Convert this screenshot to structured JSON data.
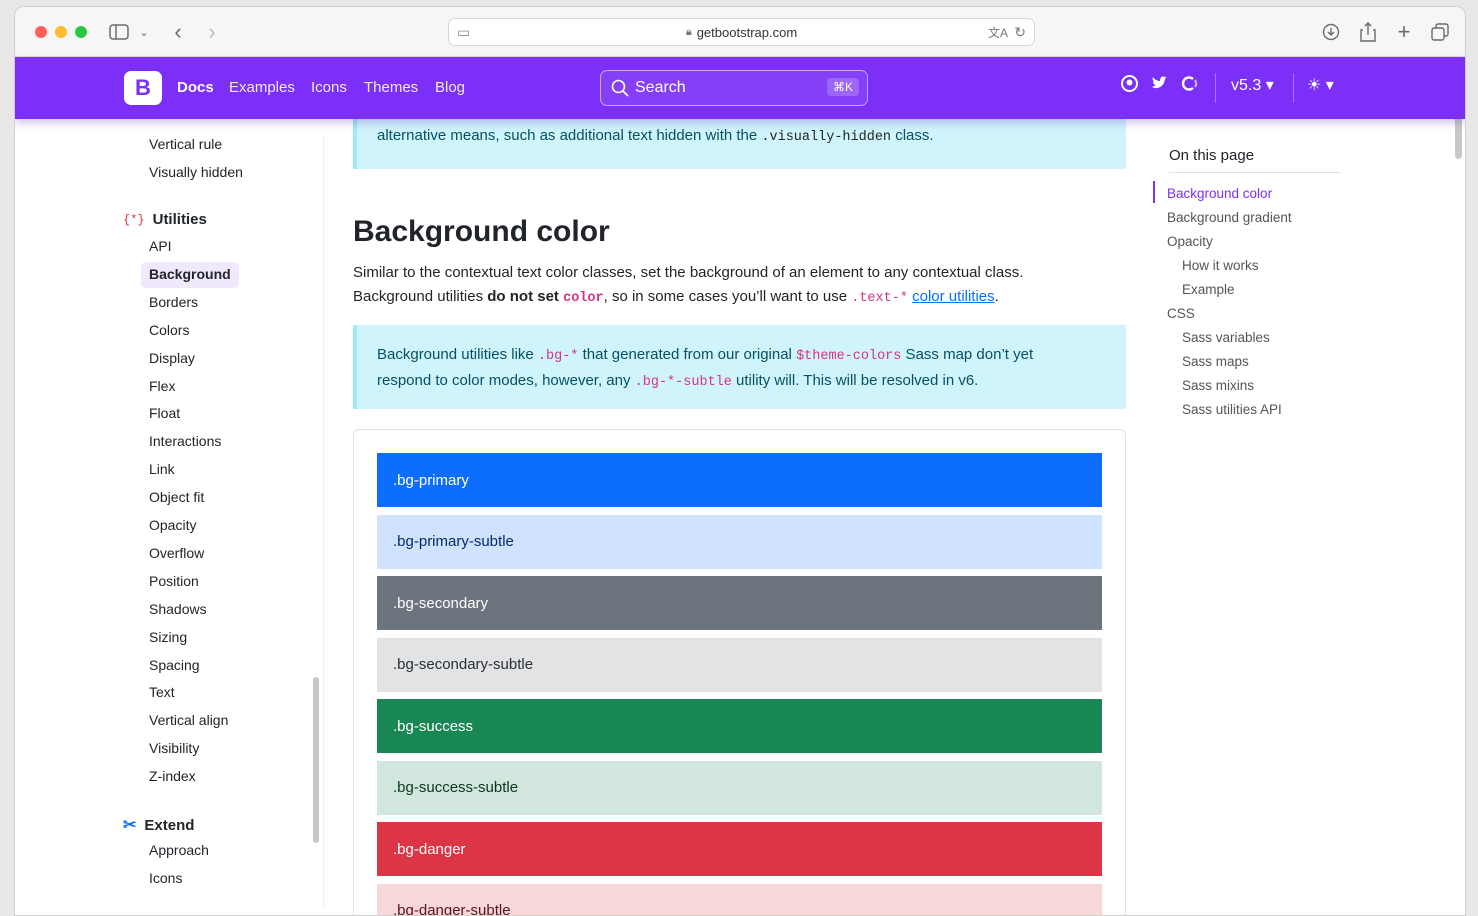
{
  "browser": {
    "url": "getbootstrap.com",
    "traffic_lights": [
      "#ff5f57",
      "#febc2e",
      "#28c840"
    ]
  },
  "navbar": {
    "brand": "B",
    "links": [
      "Docs",
      "Examples",
      "Icons",
      "Themes",
      "Blog"
    ],
    "search_placeholder": "Search",
    "search_shortcut": "⌘K",
    "version": "v5.3 ▾",
    "theme_toggle": "☀ ▾",
    "accent": "#7b2ff7"
  },
  "sidebar": {
    "top_items": [
      "Vertical rule",
      "Visually hidden"
    ],
    "utilities_heading": "Utilities",
    "utilities_items": [
      "API",
      "Background",
      "Borders",
      "Colors",
      "Display",
      "Flex",
      "Float",
      "Interactions",
      "Link",
      "Object fit",
      "Opacity",
      "Overflow",
      "Position",
      "Shadows",
      "Sizing",
      "Spacing",
      "Text",
      "Vertical align",
      "Visibility",
      "Z-index"
    ],
    "active_item": "Background",
    "extend_heading": "Extend",
    "extend_items": [
      "Approach",
      "Icons"
    ]
  },
  "main": {
    "callout_top": {
      "text_before": "alternative means, such as additional text hidden with the ",
      "code": ".visually-hidden",
      "text_after": " class."
    },
    "heading": "Background color",
    "para_line1": "Similar to the contextual text color classes, set the background of an element to any contextual class.",
    "para_line2_a": "Background utilities ",
    "para_line2_bold": "do not set",
    "para_line2_code": "color",
    "para_line2_b": ", so in some cases you’ll want to use ",
    "para_line2_code2": ".text-*",
    "para_line2_link": "color utilities",
    "para_line2_end": ".",
    "callout2": {
      "t1": "Background utilities like ",
      "c1": ".bg-*",
      "t2": " that generated from our original ",
      "c2": "$theme-colors",
      "t3": " Sass map don’t yet",
      "t4": "respond to color modes, however, any ",
      "c3": ".bg-*-subtle",
      "t5": " utility will. This will be resolved in v6."
    },
    "swatches": [
      {
        "label": ".bg-primary",
        "bg": "#0d6efd",
        "fg": "#ffffff"
      },
      {
        "label": ".bg-primary-subtle",
        "bg": "#cfe2ff",
        "fg": "#052c65"
      },
      {
        "label": ".bg-secondary",
        "bg": "#6c757d",
        "fg": "#ffffff"
      },
      {
        "label": ".bg-secondary-subtle",
        "bg": "#e2e3e5",
        "fg": "#2b2f32"
      },
      {
        "label": ".bg-success",
        "bg": "#198754",
        "fg": "#ffffff"
      },
      {
        "label": ".bg-success-subtle",
        "bg": "#d1e7dd",
        "fg": "#0a3622"
      },
      {
        "label": ".bg-danger",
        "bg": "#dc3545",
        "fg": "#ffffff"
      },
      {
        "label": ".bg-danger-subtle",
        "bg": "#f8d7da",
        "fg": "#58151c"
      }
    ]
  },
  "toc": {
    "title": "On this page",
    "items": [
      {
        "label": "Background color",
        "level": 1,
        "active": true
      },
      {
        "label": "Background gradient",
        "level": 1
      },
      {
        "label": "Opacity",
        "level": 1
      },
      {
        "label": "How it works",
        "level": 2
      },
      {
        "label": "Example",
        "level": 2
      },
      {
        "label": "CSS",
        "level": 1
      },
      {
        "label": "Sass variables",
        "level": 2
      },
      {
        "label": "Sass maps",
        "level": 2
      },
      {
        "label": "Sass mixins",
        "level": 2
      },
      {
        "label": "Sass utilities API",
        "level": 2
      }
    ]
  }
}
